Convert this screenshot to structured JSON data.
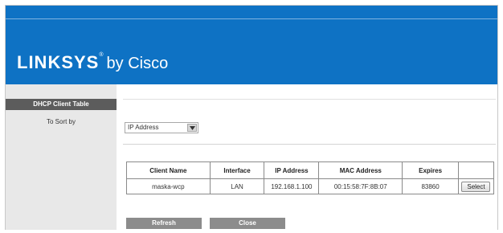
{
  "brand": {
    "name": "LINKSYS",
    "registered": "®",
    "suffix": "by Cisco"
  },
  "sidebar": {
    "heading": "DHCP Client Table",
    "sort_label": "To Sort by"
  },
  "sort": {
    "selected": "IP Address"
  },
  "table": {
    "headers": [
      "Client Name",
      "Interface",
      "IP Address",
      "MAC Address",
      "Expires",
      ""
    ],
    "rows": [
      {
        "client_name": "maska-wcp",
        "interface": "LAN",
        "ip_address": "192.168.1.100",
        "mac_address": "00:15:58:7F:8B:07",
        "expires": "83860",
        "action_label": "Select"
      }
    ]
  },
  "buttons": {
    "refresh": "Refresh",
    "close": "Close"
  },
  "colors": {
    "banner": "#0e72c4",
    "sidebar_heading": "#5c5c5c",
    "button": "#8c8c8c"
  },
  "icons": {
    "dropdown": "chevron-down-icon"
  }
}
